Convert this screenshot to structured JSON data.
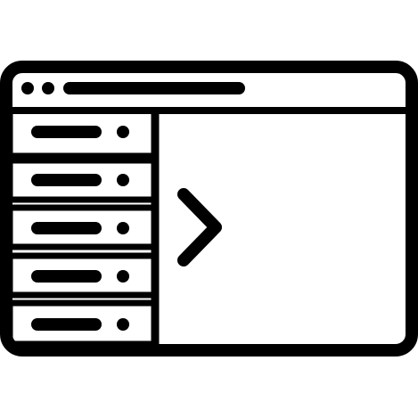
{
  "icon": {
    "name": "browser-window-sidebar-expand-icon",
    "color": "#000000",
    "background": "#ffffff"
  },
  "window": {
    "title_bar": {
      "dots": [
        "window-dot-1",
        "window-dot-2"
      ],
      "address_bar": "address-bar"
    }
  },
  "sidebar": {
    "items": [
      {
        "id": "sidebar-item-1"
      },
      {
        "id": "sidebar-item-2"
      },
      {
        "id": "sidebar-item-3"
      },
      {
        "id": "sidebar-item-4"
      },
      {
        "id": "sidebar-item-5"
      }
    ]
  },
  "main": {
    "glyph": "chevron-right-icon"
  }
}
